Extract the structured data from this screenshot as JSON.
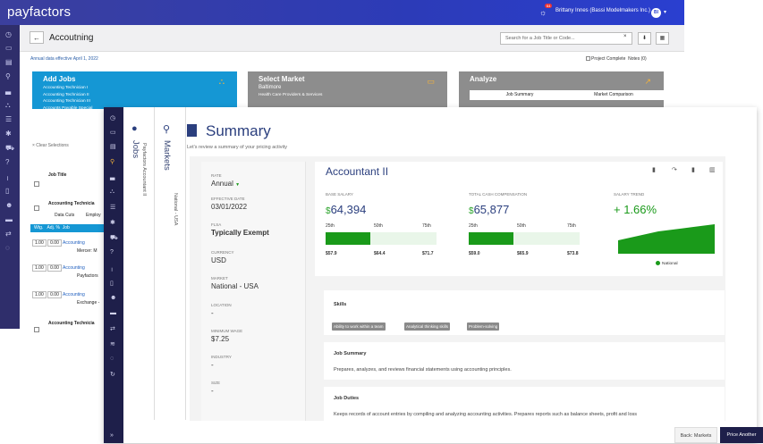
{
  "topbar": {
    "logo": "payfactors",
    "user": "Brittany Innes (Bassi Modelmakers Inc.)",
    "initials": "BI",
    "notif_count": "64"
  },
  "header": {
    "back": "←",
    "title": "Accoutning",
    "search_placeholder": "Search for a Job Title or Code...",
    "clear": "×",
    "btn1": "⬇",
    "btn2": "▦"
  },
  "effective": "Annual data effective April 1, 2022",
  "project_complete": "Project Complete",
  "notes": "Notes (0)",
  "cards": {
    "jobs": {
      "title": "Add Jobs",
      "lines": [
        "Accounting Technician I",
        "Accounting Technician II",
        "Accounting Technician III",
        "Accounts Payable Special"
      ]
    },
    "market": {
      "title": "Select Market",
      "lines": [
        "Baltimore",
        "Health Care Providers & Services"
      ]
    },
    "analyze": {
      "title": "Analyze",
      "job_summary": "Job Summary",
      "market_comparison": "Market Comparison"
    }
  },
  "leftpane": {
    "clear": "× Clear Selections",
    "col_job_title": "Job Title",
    "row1": "Accounting Technicia",
    "tabs": [
      "Data Cuts",
      "Employ"
    ],
    "wtg_headers": [
      "Wtg.",
      "Adj. %",
      "Job"
    ],
    "cuts": [
      {
        "wtg": "1.00",
        "adj": "0.00",
        "job": "Accounting",
        "src": "Mercer: M"
      },
      {
        "wtg": "1.00",
        "adj": "0.00",
        "job": "Accounting",
        "src": "Payfactors"
      },
      {
        "wtg": "1.00",
        "adj": "0.00",
        "job": "Accounting",
        "src": "Exchange -"
      }
    ],
    "row2": "Accounting Technicia"
  },
  "vtabs": {
    "jobs": {
      "label": "Jobs",
      "sub": "Payfactors Accountant II"
    },
    "markets": {
      "label": "Markets",
      "sub": "National - USA"
    }
  },
  "summary": {
    "title": "Summary",
    "subtitle": "Let's review a summary of your pricing activity",
    "fields": [
      {
        "label": "Rate",
        "value": "Annual"
      },
      {
        "label": "Effective Date",
        "value": "03/01/2022"
      },
      {
        "label": "FLSA",
        "value": "Typically Exempt"
      },
      {
        "label": "Currency",
        "value": "USD"
      },
      {
        "label": "Market",
        "value": "National - USA"
      },
      {
        "label": "Location",
        "value": "-"
      },
      {
        "label": "Minimum Wage",
        "value": "$7.25"
      },
      {
        "label": "Industry",
        "value": "-"
      },
      {
        "label": "Size",
        "value": "-"
      }
    ],
    "job_name": "Accountant II",
    "base": {
      "label": "Base Salary",
      "dollar": "$",
      "value": "64,394",
      "p25": "25th",
      "p50": "50th",
      "p75": "75th",
      "v25": "$57.9",
      "v50": "$64.4",
      "v75": "$71.7",
      "fill_fraction": 0.4
    },
    "tcc": {
      "label": "Total Cash Compensation",
      "dollar": "$",
      "value": "65,877",
      "p25": "25th",
      "p50": "50th",
      "p75": "75th",
      "v25": "$59.0",
      "v50": "$65.9",
      "v75": "$73.8",
      "fill_fraction": 0.4
    },
    "trend": {
      "label": "Salary Trend",
      "value": "+ 1.66%",
      "legend": "National"
    },
    "skills_title": "Skills",
    "skills": [
      "Ability to work within a team",
      "Analytical thinking skills",
      "Problem-solving"
    ],
    "job_summary_title": "Job Summary",
    "job_summary_text": "Prepares, analyzes, and reviews financial statements using accounting principles.",
    "job_duties_title": "Job Duties",
    "job_duties_text": "Keeps records of account entries by compiling and analyzing accounting activities. Prepares reports such as balance sheets, profit and loss"
  },
  "buttons": {
    "back": "Back: Markets",
    "price": "Price Another"
  },
  "colors": {
    "topbar": "#2c3bb8",
    "accent": "#1597d4",
    "navy": "#2b3f7e",
    "green": "#1a9a1a"
  }
}
